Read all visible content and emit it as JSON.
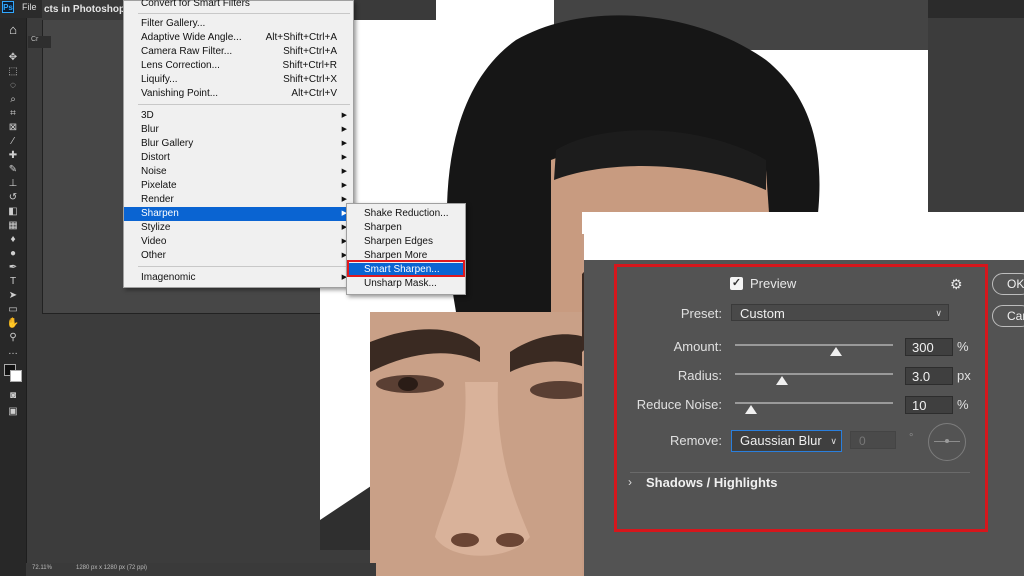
{
  "app": {
    "logo": "Ps",
    "menu_file": "File",
    "doc_title": "cts in Photoshop i",
    "tab_label": "Cr"
  },
  "filter_menu": {
    "items": [
      {
        "label": "Convert for Smart Filters",
        "shortcut": ""
      },
      {
        "label": "Filter Gallery...",
        "shortcut": ""
      },
      {
        "label": "Adaptive Wide Angle...",
        "shortcut": "Alt+Shift+Ctrl+A"
      },
      {
        "label": "Camera Raw Filter...",
        "shortcut": "Shift+Ctrl+A"
      },
      {
        "label": "Lens Correction...",
        "shortcut": "Shift+Ctrl+R"
      },
      {
        "label": "Liquify...",
        "shortcut": "Shift+Ctrl+X"
      },
      {
        "label": "Vanishing Point...",
        "shortcut": "Alt+Ctrl+V"
      },
      {
        "label": "3D"
      },
      {
        "label": "Blur"
      },
      {
        "label": "Blur Gallery"
      },
      {
        "label": "Distort"
      },
      {
        "label": "Noise"
      },
      {
        "label": "Pixelate"
      },
      {
        "label": "Render"
      },
      {
        "label": "Sharpen"
      },
      {
        "label": "Stylize"
      },
      {
        "label": "Video"
      },
      {
        "label": "Other"
      },
      {
        "label": "Imagenomic"
      }
    ]
  },
  "sharpen_submenu": {
    "items": [
      {
        "label": "Shake Reduction..."
      },
      {
        "label": "Sharpen"
      },
      {
        "label": "Sharpen Edges"
      },
      {
        "label": "Sharpen More"
      },
      {
        "label": "Smart Sharpen..."
      },
      {
        "label": "Unsharp Mask..."
      }
    ]
  },
  "status": {
    "zoom": "72.11%",
    "dims": "1280 px x 1280 px (72 ppi)"
  },
  "smart_sharpen": {
    "preview_label": "Preview",
    "preview_checked": true,
    "preset_label": "Preset:",
    "preset_value": "Custom",
    "amount_label": "Amount:",
    "amount_value": "300",
    "amount_unit": "%",
    "amount_level": 0.64,
    "radius_label": "Radius:",
    "radius_value": "3.0",
    "radius_unit": "px",
    "radius_level": 0.3,
    "noise_label": "Reduce Noise:",
    "noise_value": "10",
    "noise_unit": "%",
    "noise_level": 0.1,
    "remove_label": "Remove:",
    "remove_value": "Gaussian Blur",
    "angle_value": "0",
    "angle_unit": "°",
    "shadows_label": "Shadows / Highlights",
    "ok_label": "OK",
    "cancel_label": "Cancel"
  },
  "colors": {
    "highlight_outline": "#e0191e",
    "menu_selection": "#0a64d2",
    "dialog_bg": "#535353"
  }
}
